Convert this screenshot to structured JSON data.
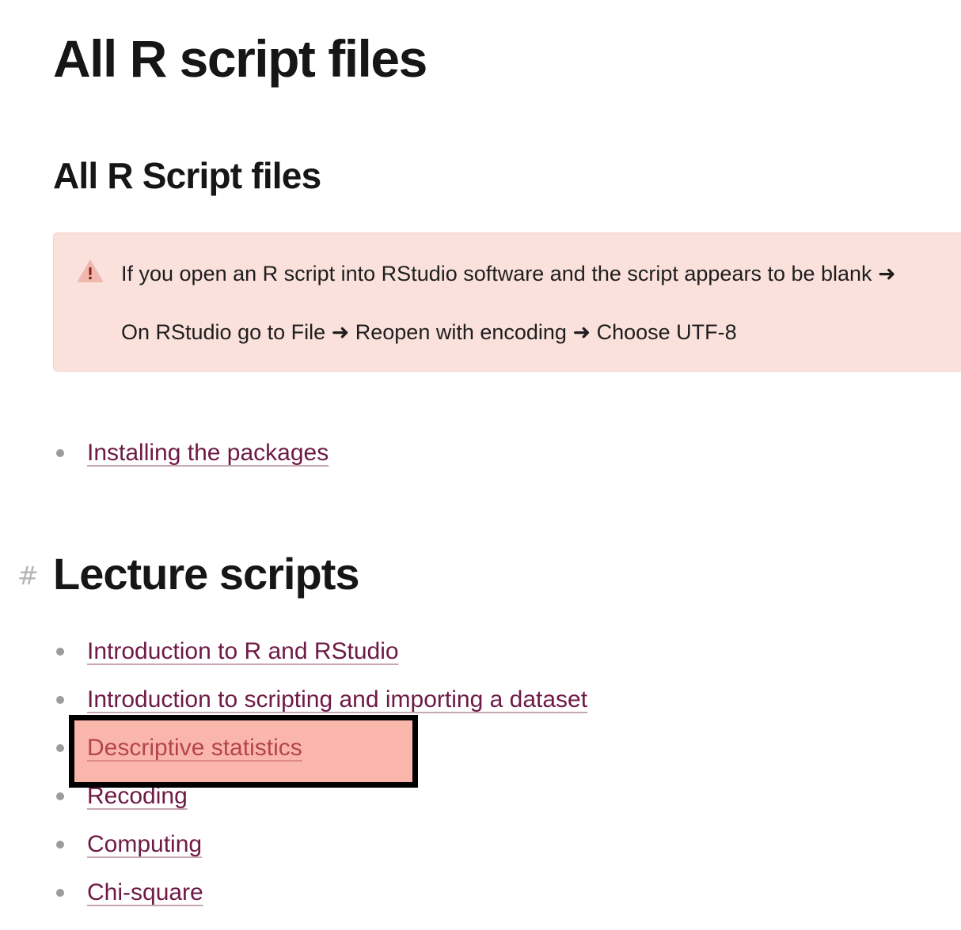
{
  "page": {
    "title": "All R script files"
  },
  "section": {
    "heading": "All R Script files"
  },
  "callout": {
    "icon": "warning-icon",
    "line1": "If you open an R script into RStudio software and the script appears to be blank ➜",
    "line2": "On RStudio go to File ➜ Reopen with encoding ➜ Choose UTF-8"
  },
  "setup_links": [
    {
      "label": "Installing the packages"
    }
  ],
  "lecture": {
    "anchor": "#",
    "heading": "Lecture scripts",
    "links": [
      {
        "label": "Introduction to R and RStudio"
      },
      {
        "label": "Introduction to scripting and importing a dataset"
      },
      {
        "label": "Descriptive statistics"
      },
      {
        "label": "Recoding"
      },
      {
        "label": "Computing"
      },
      {
        "label": "Chi-square"
      }
    ]
  },
  "colors": {
    "link": "#6e1a45",
    "callout_bg": "#fbe1dc",
    "highlight": "#f86e58"
  }
}
